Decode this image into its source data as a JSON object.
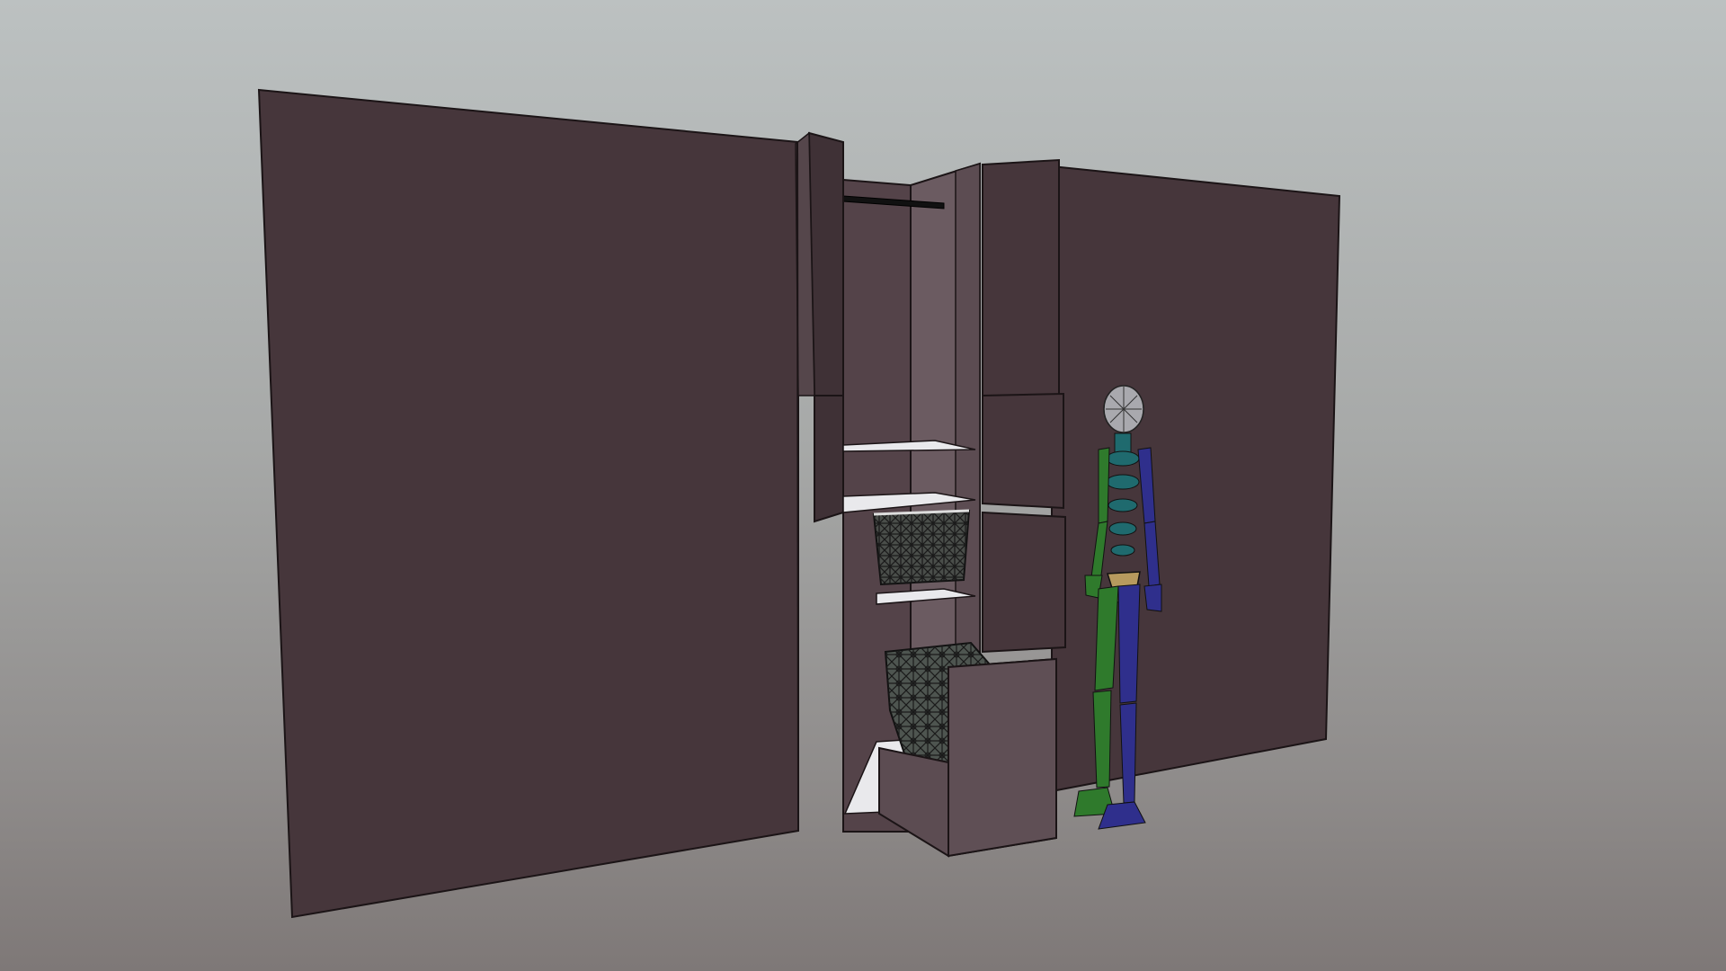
{
  "viewport": {
    "background_top": "#bcc1c1",
    "background_bottom": "#7e7877"
  },
  "scene": {
    "wall_color": "#46363b",
    "cabinet_side_color": "#6b5b61",
    "shelf_color": "#e9e9ec",
    "outline_color": "#1b1416",
    "mannequin": {
      "head_color": "#a9a9ae",
      "spine_color": "#1f6a6e",
      "left_side_color": "#2f7a2c",
      "right_side_color": "#2f2f8c",
      "pelvis_color": "#b79a5e"
    },
    "baskets": [
      "wire-basket-upper",
      "wire-basket-lower"
    ]
  }
}
